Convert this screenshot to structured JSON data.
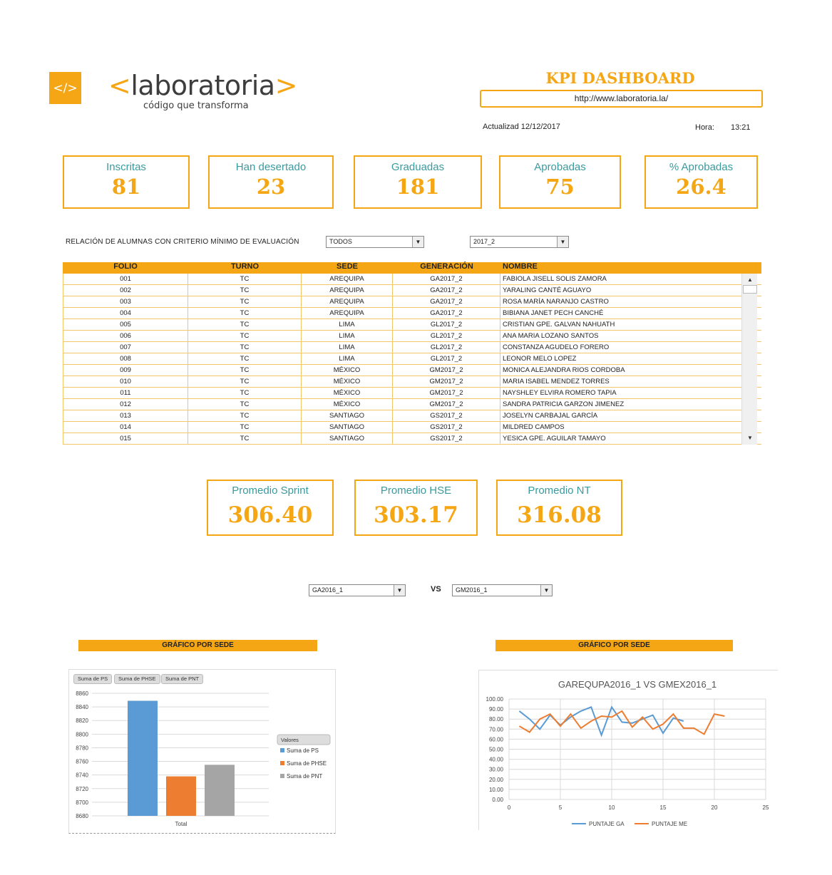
{
  "logo": {
    "icon": "</>",
    "open": "<",
    "name": "laboratoria",
    "close": ">",
    "tagline": "código que transforma"
  },
  "header": {
    "title": "KPI DASHBOARD",
    "url": "http://www.laboratoria.la/",
    "updated": "Actualizad 12/12/2017",
    "hora_label": "Hora:",
    "hora_value": "13:21"
  },
  "kpis": [
    {
      "label": "Inscritas",
      "value": "81"
    },
    {
      "label": "Han desertado",
      "value": "23"
    },
    {
      "label": "Graduadas",
      "value": "181"
    },
    {
      "label": "Aprobadas",
      "value": "75"
    },
    {
      "label": "% Aprobadas",
      "value": "26.4"
    }
  ],
  "filter": {
    "label": "RELACIÓN DE ALUMNAS CON CRITERIO MÍNIMO DE EVALUACIÓN",
    "sede_value": "TODOS",
    "generation_value": "2017_2"
  },
  "table": {
    "headers": [
      "FOLIO",
      "TURNO",
      "SEDE",
      "GENERACIÓN",
      "NOMBRE"
    ],
    "rows": [
      [
        "001",
        "TC",
        "AREQUIPA",
        "GA2017_2",
        "FABIOLA JISELL SOLIS ZAMORA"
      ],
      [
        "002",
        "TC",
        "AREQUIPA",
        "GA2017_2",
        "YARALING CANTÉ AGUAYO"
      ],
      [
        "003",
        "TC",
        "AREQUIPA",
        "GA2017_2",
        "ROSA MARÍA NARANJO CASTRO"
      ],
      [
        "004",
        "TC",
        "AREQUIPA",
        "GA2017_2",
        "BIBIANA JANET PECH CANCHÉ"
      ],
      [
        "005",
        "TC",
        "LIMA",
        "GL2017_2",
        "CRISTIAN GPE. GALVAN NAHUATH"
      ],
      [
        "006",
        "TC",
        "LIMA",
        "GL2017_2",
        "ANA MARIA LOZANO SANTOS"
      ],
      [
        "007",
        "TC",
        "LIMA",
        "GL2017_2",
        "CONSTANZA AGUDELO FORERO"
      ],
      [
        "008",
        "TC",
        "LIMA",
        "GL2017_2",
        "LEONOR MELO LOPEZ"
      ],
      [
        "009",
        "TC",
        "MÉXICO",
        "GM2017_2",
        "MONICA ALEJANDRA RIOS CORDOBA"
      ],
      [
        "010",
        "TC",
        "MÉXICO",
        "GM2017_2",
        "MARIA ISABEL MENDEZ TORRES"
      ],
      [
        "011",
        "TC",
        "MÉXICO",
        "GM2017_2",
        "NAYSHLEY ELVIRA ROMERO TAPIA"
      ],
      [
        "012",
        "TC",
        "MÉXICO",
        "GM2017_2",
        "SANDRA PATRICIA GARZON JIMENEZ"
      ],
      [
        "013",
        "TC",
        "SANTIAGO",
        "GS2017_2",
        "JOSELYN CARBAJAL GARCÍA"
      ],
      [
        "014",
        "TC",
        "SANTIAGO",
        "GS2017_2",
        "MILDRED CAMPOS"
      ],
      [
        "015",
        "TC",
        "SANTIAGO",
        "GS2017_2",
        "YESICA GPE. AGUILAR TAMAYO"
      ]
    ]
  },
  "averages": [
    {
      "label": "Promedio Sprint",
      "value": "306.40"
    },
    {
      "label": "Promedio HSE",
      "value": "303.17"
    },
    {
      "label": "Promedio NT",
      "value": "316.08"
    }
  ],
  "compare": {
    "left": "GA2016_1",
    "vs": "VS",
    "right": "GM2016_1"
  },
  "sections": {
    "left": "GRÁFICO POR SEDE",
    "right": "GRÁFICO POR SEDE"
  },
  "chart_data": [
    {
      "type": "bar",
      "categories": [
        "Total"
      ],
      "series": [
        {
          "name": "Suma de PS",
          "values": [
            8849
          ],
          "color": "#5b9bd5"
        },
        {
          "name": "Suma de PHSE",
          "values": [
            8738
          ],
          "color": "#ed7d31"
        },
        {
          "name": "Suma de PNT",
          "values": [
            8755
          ],
          "color": "#a5a5a5"
        }
      ],
      "field_buttons": [
        "Suma de PS",
        "Suma de PHSE",
        "Suma de PNT"
      ],
      "legend_title": "Valores",
      "ylim": [
        8680,
        8860
      ],
      "yticks": [
        8680,
        8700,
        8720,
        8740,
        8760,
        8780,
        8800,
        8820,
        8840,
        8860
      ],
      "grid": true,
      "legend": "right"
    },
    {
      "type": "line",
      "title": "GAREQUPA2016_1 VS GMEX2016_1",
      "xlim": [
        0,
        25
      ],
      "xticks": [
        0,
        5,
        10,
        15,
        20,
        25
      ],
      "ylim": [
        0,
        100
      ],
      "yticks": [
        "0.00",
        "10.00",
        "20.00",
        "30.00",
        "40.00",
        "50.00",
        "60.00",
        "70.00",
        "80.00",
        "90.00",
        "100.00"
      ],
      "grid": true,
      "legend": "bottom",
      "series": [
        {
          "name": "PUNTAJE GA",
          "color": "#5b9bd5",
          "x": [
            1,
            2,
            3,
            4,
            5,
            6,
            7,
            8,
            9,
            10,
            11,
            12,
            13,
            14,
            15,
            16,
            17
          ],
          "y": [
            88,
            80,
            70,
            84,
            74,
            82,
            88,
            92,
            64,
            92,
            77,
            76,
            80,
            84,
            66,
            81,
            78
          ]
        },
        {
          "name": "PUNTAJE ME",
          "color": "#ed7d31",
          "x": [
            1,
            2,
            3,
            4,
            5,
            6,
            7,
            8,
            9,
            10,
            11,
            12,
            13,
            14,
            15,
            16,
            17,
            18,
            19,
            20,
            21
          ],
          "y": [
            73,
            67,
            80,
            85,
            73,
            85,
            71,
            78,
            83,
            82,
            88,
            72,
            82,
            70,
            75,
            85,
            71,
            71,
            65,
            85,
            83
          ]
        }
      ]
    }
  ]
}
